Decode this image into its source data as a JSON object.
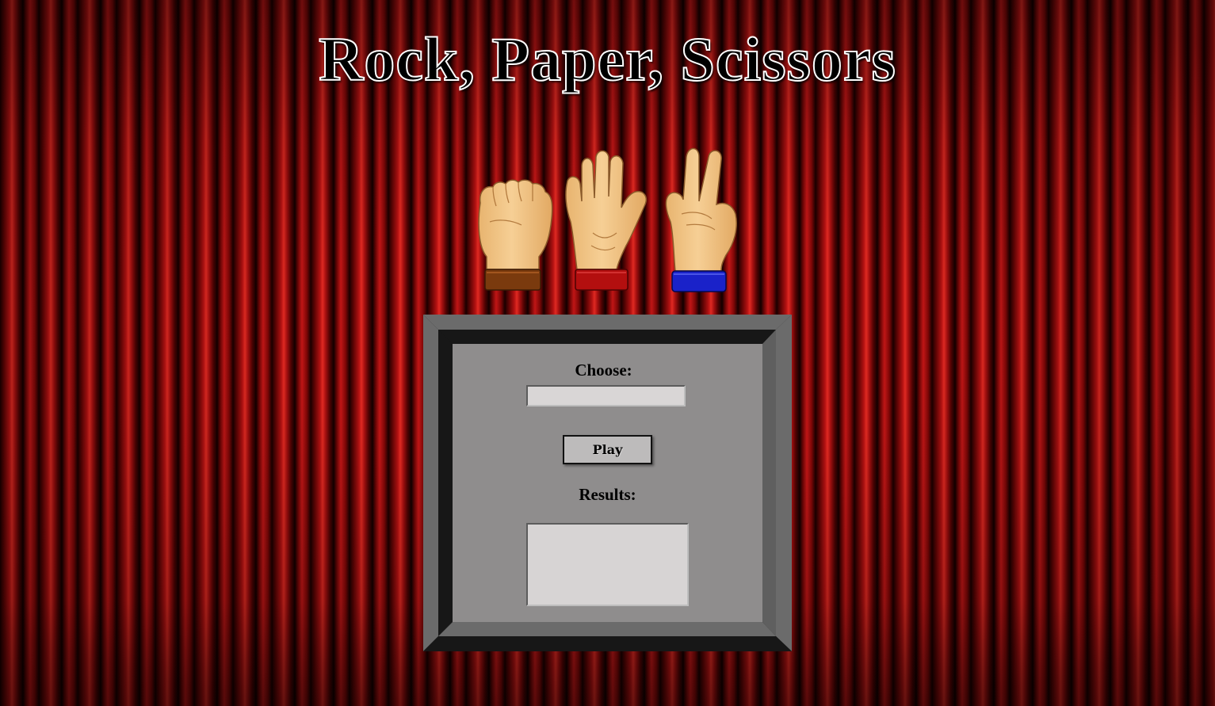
{
  "page": {
    "title": "Rock, Paper, Scissors"
  },
  "hands": [
    {
      "name": "rock",
      "cuff_color": "#7a3a0e"
    },
    {
      "name": "paper",
      "cuff_color": "#b30f0f"
    },
    {
      "name": "scissors",
      "cuff_color": "#1a22c9"
    }
  ],
  "game": {
    "choose_label": "Choose:",
    "choice_value": "",
    "choice_placeholder": "",
    "play_label": "Play",
    "results_label": "Results:",
    "results_value": ""
  },
  "colors": {
    "curtain": "#b41212",
    "panel": "#8f8d8d",
    "frame_dark": "#171717",
    "frame_light": "#6b6b6b",
    "skin": "#f2c486"
  }
}
